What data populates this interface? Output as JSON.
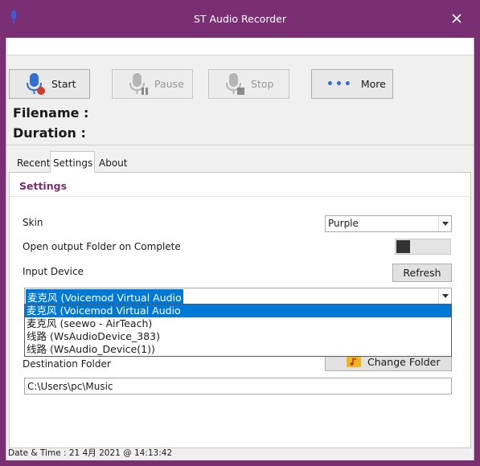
{
  "window": {
    "title": "ST Audio Recorder"
  },
  "toolbar": {
    "start_label": "Start",
    "pause_label": "Pause",
    "stop_label": "Stop",
    "more_label": "More"
  },
  "info": {
    "filename_label": "Filename :",
    "duration_label": "Duration :"
  },
  "tabs": [
    {
      "label": "Recent",
      "active": false
    },
    {
      "label": "Settings",
      "active": true
    },
    {
      "label": "About",
      "active": false
    }
  ],
  "settings": {
    "title": "Settings",
    "skin_label": "Skin",
    "skin_value": "Purple",
    "open_output_label": "Open output Folder on Complete",
    "open_output_enabled": false,
    "input_device_label": "Input Device",
    "refresh_label": "Refresh",
    "input_device_value": "麦克风 (Voicemod Virtual Audio",
    "input_device_options": [
      "麦克风 (Voicemod Virtual Audio",
      "麦克风 (seewo - AirTeach)",
      "线路 (WsAudioDevice_383)",
      "线路 (WsAudio_Device(1))"
    ],
    "selected_option_index": 0,
    "change_folder_label": "Change Folder",
    "destination_folder_label": "Destination Folder",
    "destination_folder_value": "C:\\Users\\pc\\Music"
  },
  "status": {
    "datetime": "Date & Time : 21 4月 2021 @ 14:13:42"
  },
  "colors": {
    "accent": "#7a2f73",
    "selection": "#0078d7",
    "record_dot": "#d23a2a",
    "mic": "#2f6fd6"
  },
  "icons": {
    "app": "microphone-icon",
    "close": "close-icon",
    "start": "microphone-record-icon",
    "pause": "microphone-pause-icon",
    "stop": "microphone-stop-icon",
    "more": "ellipsis-icon",
    "combo_arrow": "chevron-down-icon",
    "folder": "music-folder-icon"
  }
}
